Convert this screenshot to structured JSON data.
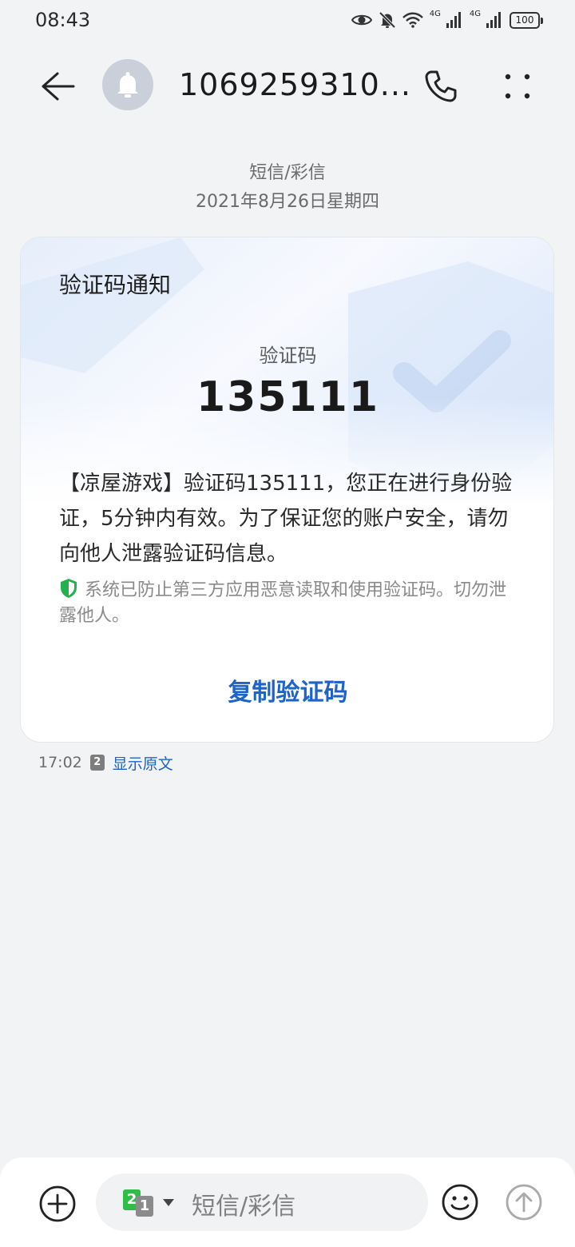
{
  "status_bar": {
    "time": "08:43",
    "network_1": "4G",
    "network_2": "4G",
    "battery": "100"
  },
  "header": {
    "sender": "1069259310...",
    "icons": [
      "back-arrow-icon",
      "bell-icon",
      "phone-icon",
      "more-icon"
    ]
  },
  "conversation": {
    "message_type": "短信/彩信",
    "date": "2021年8月26日星期四"
  },
  "card": {
    "title": "验证码通知",
    "code_label": "验证码",
    "code_value": "135111",
    "body": "【凉屋游戏】验证码135111，您正在进行身份验证，5分钟内有效。为了保证您的账户安全，请勿向他人泄露验证码信息。",
    "notice": "系统已防止第三方应用恶意读取和使用验证码。切勿泄露他人。",
    "copy_button": "复制验证码",
    "accent_color": "#1d63c9",
    "shield_color": "#22b14c"
  },
  "message_footer": {
    "time": "17:02",
    "sim": "2",
    "show_original": "显示原文"
  },
  "composer": {
    "sim_primary": "2",
    "sim_secondary": "1",
    "placeholder": "短信/彩信"
  }
}
